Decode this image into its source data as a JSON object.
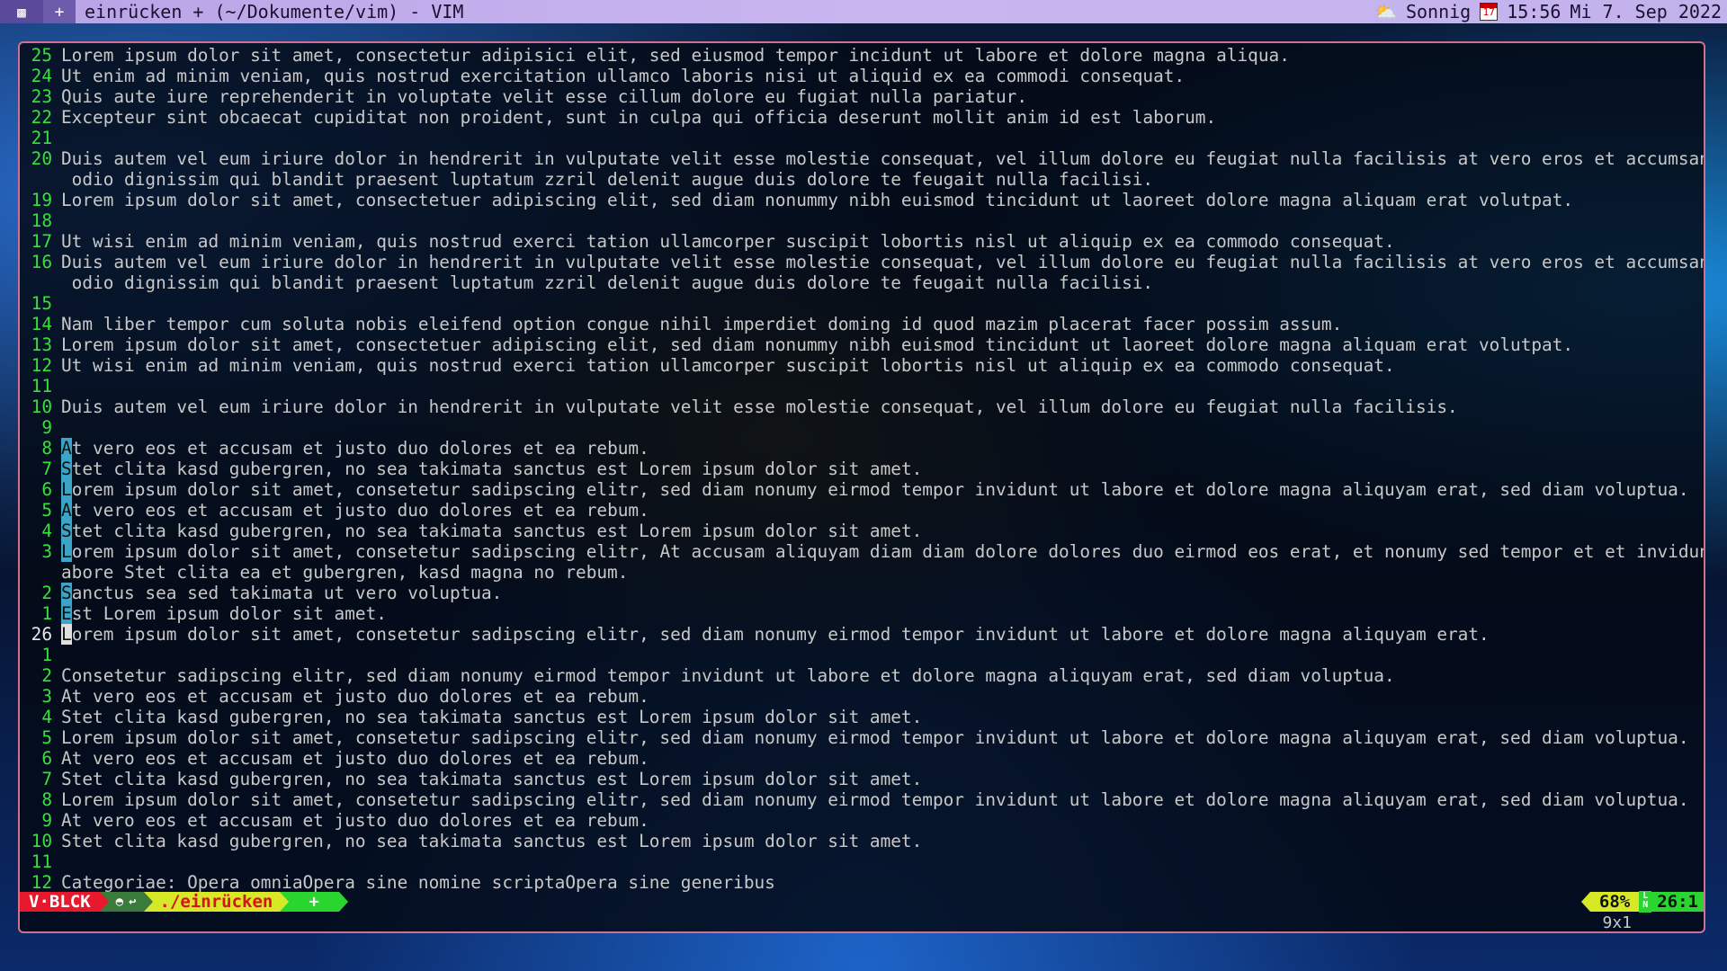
{
  "topbar": {
    "plus": "+",
    "title": "einrücken + (~/Dokumente/vim) - VIM",
    "weather": "Sonnig",
    "time": "15:56",
    "date": "Mi  7. Sep 2022",
    "calendar_day": "17",
    "icons": [
      "terminal-icon",
      "weather-icon",
      "calendar-icon"
    ]
  },
  "editor": {
    "lines": [
      {
        "num": "25",
        "text": "Lorem ipsum dolor sit amet, consectetur adipisici elit, sed eiusmod tempor incidunt ut labore et dolore magna aliqua."
      },
      {
        "num": "24",
        "text": "Ut enim ad minim veniam, quis nostrud exercitation ullamco laboris nisi ut aliquid ex ea commodi consequat."
      },
      {
        "num": "23",
        "text": "Quis aute iure reprehenderit in voluptate velit esse cillum dolore eu fugiat nulla pariatur."
      },
      {
        "num": "22",
        "text": "Excepteur sint obcaecat cupiditat non proident, sunt in culpa qui officia deserunt mollit anim id est laborum."
      },
      {
        "num": "21",
        "text": ""
      },
      {
        "num": "20",
        "text": "Duis autem vel eum iriure dolor in hendrerit in vulputate velit esse molestie consequat, vel illum dolore eu feugiat nulla facilisis at vero eros et accumsan et iusto"
      },
      {
        "num": "",
        "text": " odio dignissim qui blandit praesent luptatum zzril delenit augue duis dolore te feugait nulla facilisi.",
        "wrap": true
      },
      {
        "num": "19",
        "text": "Lorem ipsum dolor sit amet, consectetuer adipiscing elit, sed diam nonummy nibh euismod tincidunt ut laoreet dolore magna aliquam erat volutpat."
      },
      {
        "num": "18",
        "text": ""
      },
      {
        "num": "17",
        "text": "Ut wisi enim ad minim veniam, quis nostrud exerci tation ullamcorper suscipit lobortis nisl ut aliquip ex ea commodo consequat."
      },
      {
        "num": "16",
        "text": "Duis autem vel eum iriure dolor in hendrerit in vulputate velit esse molestie consequat, vel illum dolore eu feugiat nulla facilisis at vero eros et accumsan et iusto"
      },
      {
        "num": "",
        "text": " odio dignissim qui blandit praesent luptatum zzril delenit augue duis dolore te feugait nulla facilisi.",
        "wrap": true
      },
      {
        "num": "15",
        "text": ""
      },
      {
        "num": "14",
        "text": "Nam liber tempor cum soluta nobis eleifend option congue nihil imperdiet doming id quod mazim placerat facer possim assum."
      },
      {
        "num": "13",
        "text": "Lorem ipsum dolor sit amet, consectetuer adipiscing elit, sed diam nonummy nibh euismod tincidunt ut laoreet dolore magna aliquam erat volutpat."
      },
      {
        "num": "12",
        "text": "Ut wisi enim ad minim veniam, quis nostrud exerci tation ullamcorper suscipit lobortis nisl ut aliquip ex ea commodo consequat."
      },
      {
        "num": "11",
        "text": ""
      },
      {
        "num": "10",
        "text": "Duis autem vel eum iriure dolor in hendrerit in vulputate velit esse molestie consequat, vel illum dolore eu feugiat nulla facilisis."
      },
      {
        "num": "9",
        "text": ""
      },
      {
        "num": "8",
        "sel": "A",
        "text": "t vero eos et accusam et justo duo dolores et ea rebum."
      },
      {
        "num": "7",
        "sel": "S",
        "text": "tet clita kasd gubergren, no sea takimata sanctus est Lorem ipsum dolor sit amet."
      },
      {
        "num": "6",
        "sel": "L",
        "text": "orem ipsum dolor sit amet, consetetur sadipscing elitr, sed diam nonumy eirmod tempor invidunt ut labore et dolore magna aliquyam erat, sed diam voluptua."
      },
      {
        "num": "5",
        "sel": "A",
        "text": "t vero eos et accusam et justo duo dolores et ea rebum."
      },
      {
        "num": "4",
        "sel": "S",
        "text": "tet clita kasd gubergren, no sea takimata sanctus est Lorem ipsum dolor sit amet."
      },
      {
        "num": "3",
        "sel": "L",
        "text": "orem ipsum dolor sit amet, consetetur sadipscing elitr, At accusam aliquyam diam diam dolore dolores duo eirmod eos erat, et nonumy sed tempor et et invidunt justo l"
      },
      {
        "num": "",
        "text": "abore Stet clita ea et gubergren, kasd magna no rebum.",
        "wrap": true
      },
      {
        "num": "2",
        "sel": "S",
        "text": "anctus sea sed takimata ut vero voluptua."
      },
      {
        "num": "1",
        "sel": "E",
        "text": "st Lorem ipsum dolor sit amet."
      },
      {
        "num": "26",
        "cursor": "L",
        "text": "orem ipsum dolor sit amet, consetetur sadipscing elitr, sed diam nonumy eirmod tempor invidunt ut labore et dolore magna aliquyam erat.",
        "current": true
      },
      {
        "num": "1",
        "text": ""
      },
      {
        "num": "2",
        "text": "Consetetur sadipscing elitr, sed diam nonumy eirmod tempor invidunt ut labore et dolore magna aliquyam erat, sed diam voluptua."
      },
      {
        "num": "3",
        "text": "At vero eos et accusam et justo duo dolores et ea rebum."
      },
      {
        "num": "4",
        "text": "Stet clita kasd gubergren, no sea takimata sanctus est Lorem ipsum dolor sit amet."
      },
      {
        "num": "5",
        "text": "Lorem ipsum dolor sit amet, consetetur sadipscing elitr, sed diam nonumy eirmod tempor invidunt ut labore et dolore magna aliquyam erat, sed diam voluptua."
      },
      {
        "num": "6",
        "text": "At vero eos et accusam et justo duo dolores et ea rebum."
      },
      {
        "num": "7",
        "text": "Stet clita kasd gubergren, no sea takimata sanctus est Lorem ipsum dolor sit amet."
      },
      {
        "num": "8",
        "text": "Lorem ipsum dolor sit amet, consetetur sadipscing elitr, sed diam nonumy eirmod tempor invidunt ut labore et dolore magna aliquyam erat, sed diam voluptua."
      },
      {
        "num": "9",
        "text": "At vero eos et accusam et justo duo dolores et ea rebum."
      },
      {
        "num": "10",
        "text": "Stet clita kasd gubergren, no sea takimata sanctus est Lorem ipsum dolor sit amet."
      },
      {
        "num": "11",
        "text": ""
      },
      {
        "num": "12",
        "text": "Categoriae: Opera omniaOpera sine nomine scriptaOpera sine generibus"
      }
    ]
  },
  "statusline": {
    "mode": "V·BLCK",
    "file": "./einrücken",
    "modified": "+",
    "percent": "68%",
    "ln_top": "L",
    "ln_bottom": "N",
    "position": "26:1",
    "colors": {
      "mode": "#e8192c",
      "file": "#d6e826",
      "ok": "#2ad52f"
    }
  },
  "cmdline": {
    "selection_size": "9x1"
  }
}
